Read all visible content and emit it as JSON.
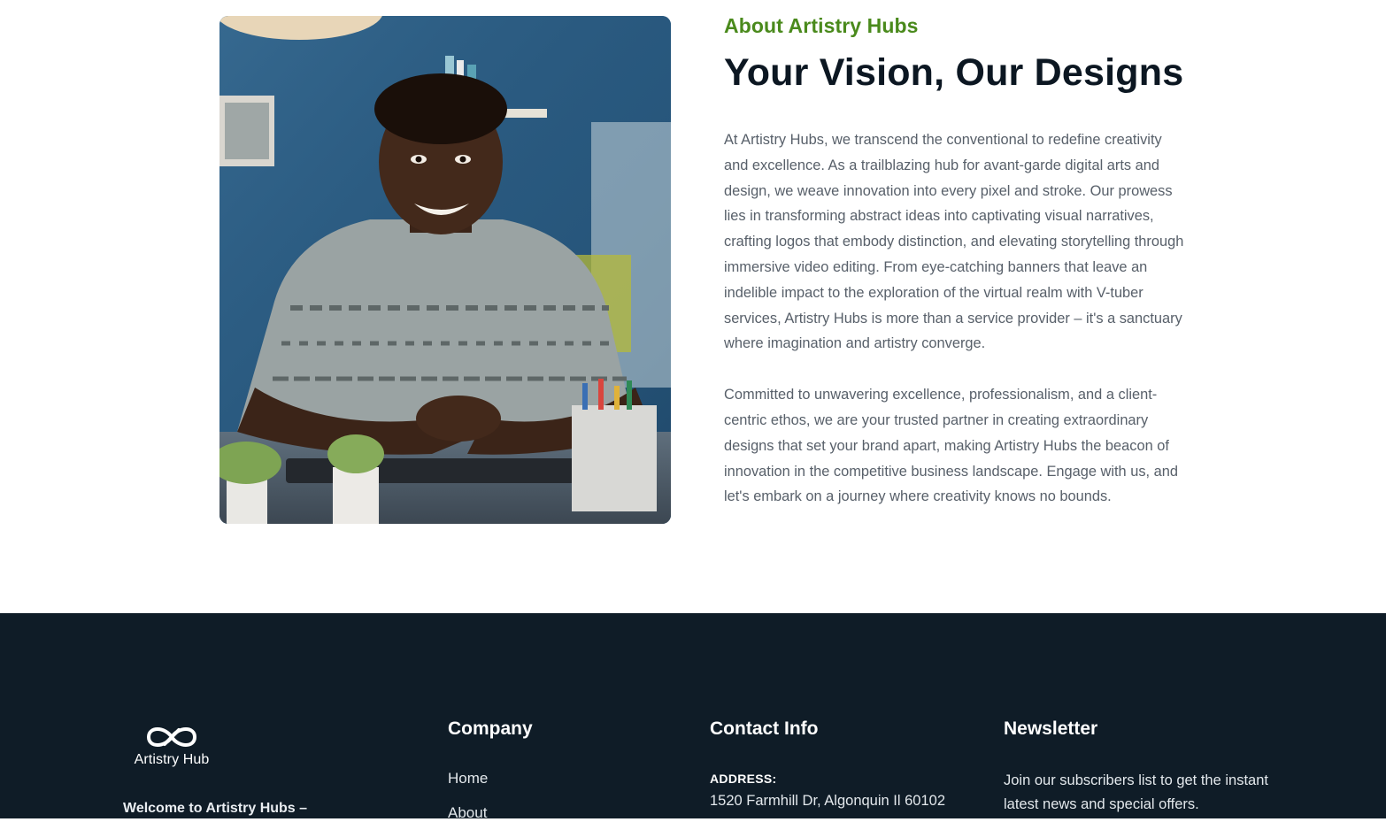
{
  "about": {
    "eyebrow": "About Artistry Hubs",
    "headline": "Your Vision, Our Designs",
    "paragraph_1": "At Artistry Hubs, we transcend the conventional to redefine creativity and excellence. As a trailblazing hub for avant-garde digital arts and design, we weave innovation into every pixel and stroke. Our prowess lies in transforming abstract ideas into captivating visual narratives, crafting logos that embody distinction, and elevating storytelling through immersive video editing. From eye-catching banners that leave an indelible impact to the exploration of the virtual realm with V-tuber services, Artistry Hubs is more than a service provider – it's a sanctuary where imagination and artistry converge.",
    "paragraph_2": "Committed to unwavering excellence, professionalism, and a client-centric ethos, we are your trusted partner in creating extraordinary designs that set your brand apart, making Artistry Hubs the beacon of innovation in the competitive business landscape. Engage with us, and let's embark on a journey where creativity knows no bounds."
  },
  "footer": {
    "logo_text": "Artistry Hub",
    "welcome": "Welcome to Artistry Hubs –",
    "company": {
      "title": "Company",
      "links": [
        "Home",
        "About"
      ]
    },
    "contact": {
      "title": "Contact Info",
      "address_label": "ADDRESS:",
      "address_value": "1520 Farmhill Dr, Algonquin Il 60102"
    },
    "newsletter": {
      "title": "Newsletter",
      "text": "Join our subscribers list to get the instant latest news and special offers."
    }
  },
  "colors": {
    "accent_green": "#4a8a1c",
    "headline": "#0c1722",
    "body_text": "#58606a",
    "footer_bg": "#0f1c27"
  }
}
